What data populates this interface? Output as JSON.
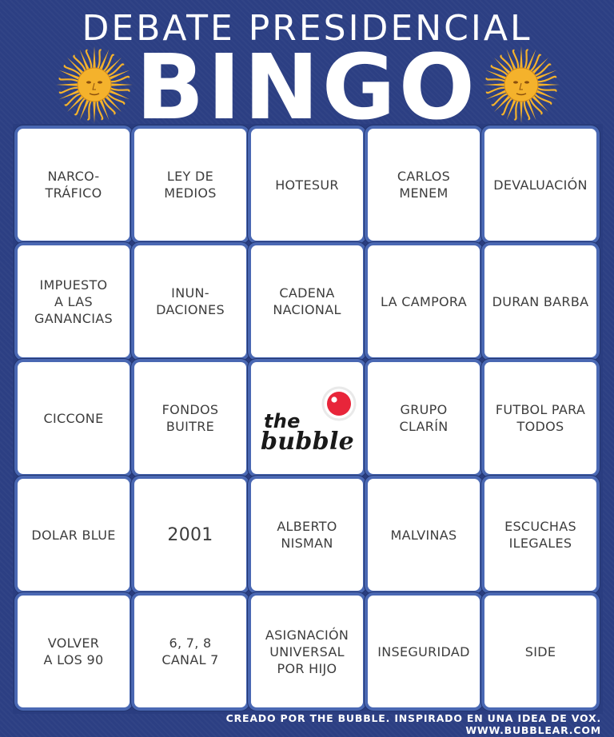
{
  "header": {
    "subtitle": "DEBATE PRESIDENCIAL",
    "title": "BINGO"
  },
  "colors": {
    "background": "#2c3f83",
    "cell_border": "#4a68b3",
    "sun": "#f4b22c",
    "logo_red": "#e8253a"
  },
  "icons": {
    "left": "sun-of-may-icon",
    "right": "sun-of-may-icon",
    "center": "the-bubble-logo"
  },
  "board": {
    "rows": [
      [
        "NARCO-\nTRÁFICO",
        "LEY DE\nMEDIOS",
        "HOTESUR",
        "CARLOS\nMENEM",
        "DEVALUACIÓN"
      ],
      [
        "IMPUESTO\nA LAS\nGANANCIAS",
        "INUN-\nDACIONES",
        "CADENA\nNACIONAL",
        "LA CAMPORA",
        "DURAN BARBA"
      ],
      [
        "CICCONE",
        "FONDOS\nBUITRE",
        "",
        "GRUPO\nCLARÍN",
        "FUTBOL PARA\nTODOS"
      ],
      [
        "DOLAR BLUE",
        "2001",
        "ALBERTO\nNISMAN",
        "MALVINAS",
        "ESCUCHAS\nILEGALES"
      ],
      [
        "VOLVER\nA LOS 90",
        "6, 7, 8\nCANAL 7",
        "ASIGNACIÓN\nUNIVERSAL\nPOR HIJO",
        "INSEGURIDAD",
        "SIDE"
      ]
    ],
    "logo_text_1": "the",
    "logo_text_2": "bubble"
  },
  "footer": {
    "credit": "CREADO POR THE BUBBLE. INSPIRADO EN UNA IDEA DE VOX.",
    "url": "WWW.BUBBLEAR.COM"
  }
}
